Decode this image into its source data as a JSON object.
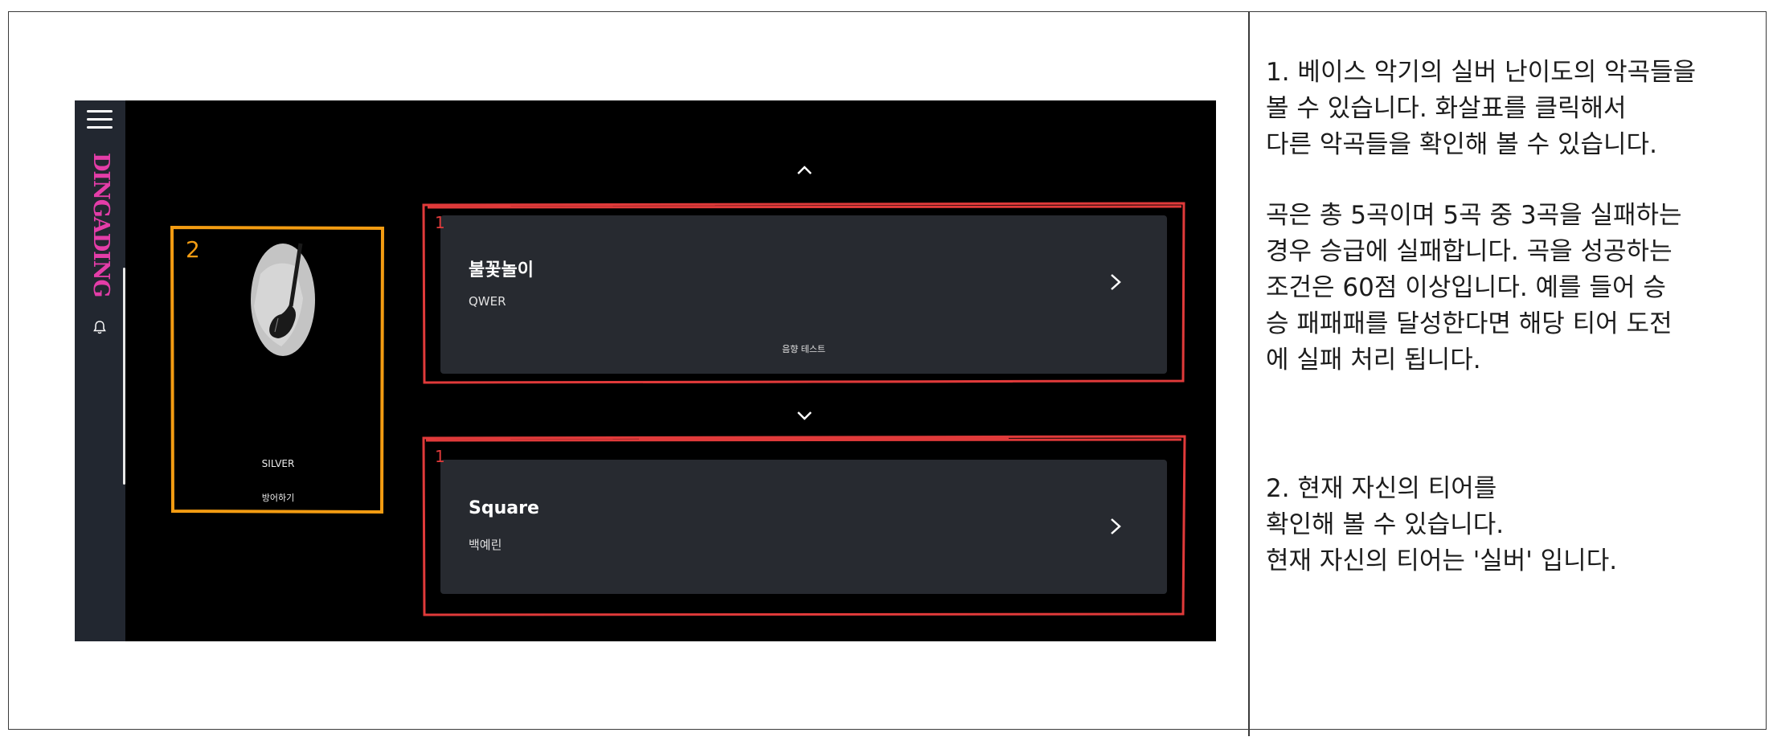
{
  "app": {
    "logo_text": "DINGADING",
    "tier": {
      "name": "SILVER",
      "action_label": "방어하기"
    },
    "songs": [
      {
        "title": "불꽃놀이",
        "artist": "QWER",
        "extra_label": "음향 테스트"
      },
      {
        "title": "Square",
        "artist": "백예린"
      }
    ],
    "icons": {
      "menu": "hamburger-menu-icon",
      "bell": "bell-icon",
      "prev": "chevron-up-icon",
      "next": "chevron-down-icon",
      "open": "chevron-right-icon",
      "tier_image": "bass-guitar-icon"
    }
  },
  "annotations": {
    "song_marker_1": "1",
    "song_marker_2": "1",
    "tier_marker": "2",
    "song_box_color": "#e03a3a",
    "tier_box_color": "#f39c12"
  },
  "notes": {
    "note1": [
      "1. 베이스 악기의 실버 난이도의 악곡들을",
      "볼 수 있습니다. 화살표를 클릭해서",
      "다른 악곡들을 확인해 볼 수 있습니다."
    ],
    "note2": [
      "곡은 총 5곡이며 5곡 중 3곡을 실패하는",
      "경우 승급에 실패합니다. 곡을 성공하는",
      "조건은 60점 이상입니다. 예를 들어 승",
      "승 패패패를 달성한다면 해당 티어 도전",
      "에 실패 처리 됩니다."
    ],
    "note3": [
      "2. 현재 자신의 티어를",
      "확인해 볼 수 있습니다.",
      "현재 자신의 티어는 '실버' 입니다."
    ]
  },
  "colors": {
    "app_background": "#000000",
    "sidebar": "#222730",
    "card": "#272a30",
    "logo": "#e43da8"
  }
}
